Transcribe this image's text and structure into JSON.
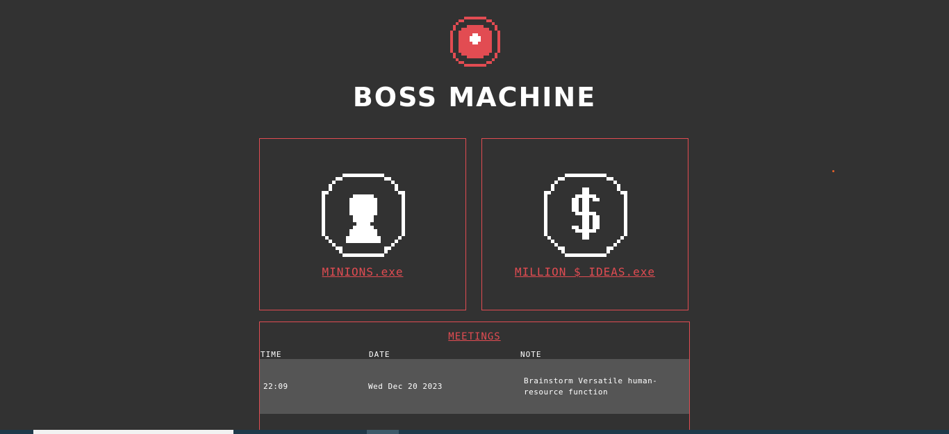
{
  "header": {
    "title": "BOSS MACHINE",
    "logo_icon": "red-pixel-coin-logo-icon"
  },
  "cards": [
    {
      "label": "MINIONS.exe",
      "icon": "minion-icon"
    },
    {
      "label": "MILLION $ IDEAS.exe",
      "icon": "dollar-coin-icon"
    }
  ],
  "meetings": {
    "title": "MEETINGS",
    "columns": [
      "TIME",
      "DATE",
      "NOTE"
    ],
    "rows": [
      {
        "time": "22:09",
        "date": "Wed Dec 20 2023",
        "note_line1": "Brainstorm Versatile human-",
        "note_line2": "resource function"
      }
    ]
  },
  "colors": {
    "background": "#323232",
    "accent": "#e24c52",
    "row_bg": "#555555",
    "text": "#ffffff"
  }
}
